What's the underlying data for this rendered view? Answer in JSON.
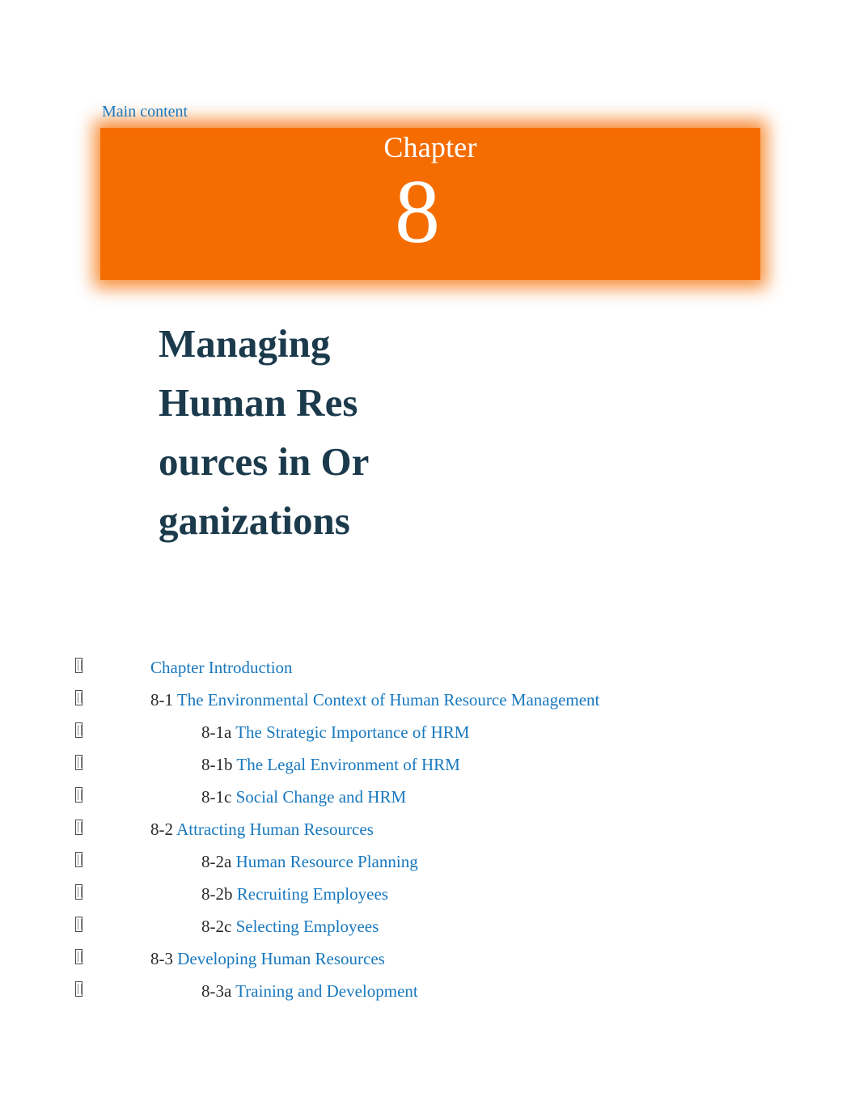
{
  "page": {
    "background_color": "#ffffff",
    "accent_orange": "#f56d00",
    "link_blue": "#1878be",
    "title_navy": "#1b3a4c",
    "number_gray": "#2a2a2a"
  },
  "skip_link": {
    "label": "Main content"
  },
  "banner": {
    "word": "Chapter",
    "number": "8",
    "background_color": "#f56d00",
    "text_color": "#ffffff"
  },
  "chapter": {
    "title": "Managing Human Resources in Organizations"
  },
  "toc": {
    "items": [
      {
        "level": 1,
        "number": "",
        "title": "Chapter Introduction"
      },
      {
        "level": 1,
        "number": "8-1",
        "title": "The Environmental Context of Human Resource Management"
      },
      {
        "level": 2,
        "number": "8-1a",
        "title": "The Strategic Importance of HRM"
      },
      {
        "level": 2,
        "number": "8-1b",
        "title": "The Legal Environment of HRM"
      },
      {
        "level": 2,
        "number": "8-1c",
        "title": "Social Change and HRM"
      },
      {
        "level": 1,
        "number": "8-2",
        "title": "Attracting Human Resources"
      },
      {
        "level": 2,
        "number": "8-2a",
        "title": "Human Resource Planning"
      },
      {
        "level": 2,
        "number": "8-2b",
        "title": "Recruiting Employees"
      },
      {
        "level": 2,
        "number": "8-2c",
        "title": "Selecting Employees"
      },
      {
        "level": 1,
        "number": "8-3",
        "title": "Developing Human Resources"
      },
      {
        "level": 2,
        "number": "8-3a",
        "title": "Training and Development"
      }
    ]
  }
}
